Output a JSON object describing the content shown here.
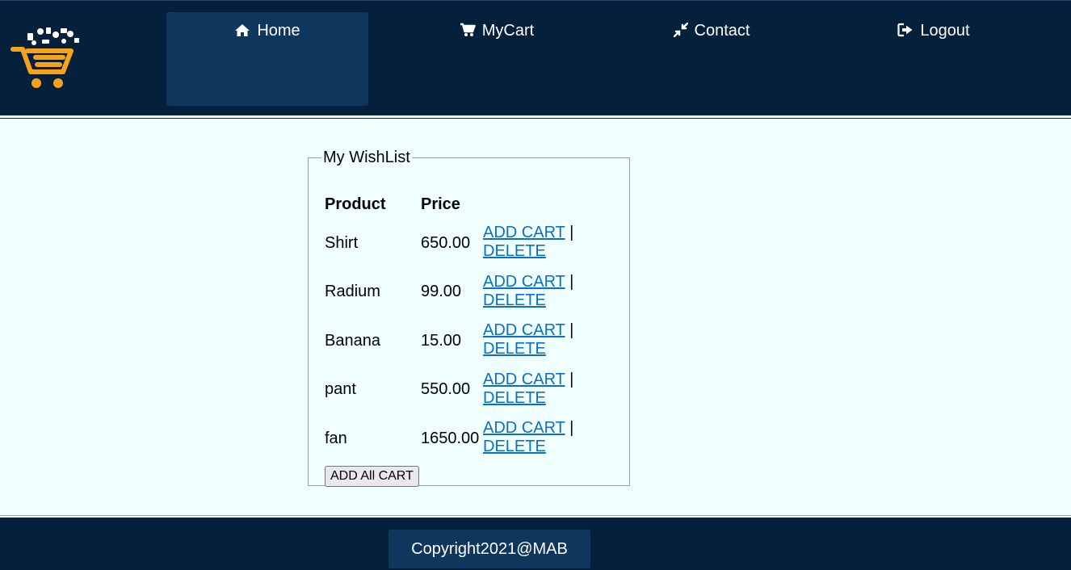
{
  "header": {
    "nav": [
      {
        "label": "Home",
        "icon": "home-icon",
        "active": true
      },
      {
        "label": "MyCart",
        "icon": "cart-icon",
        "active": false
      },
      {
        "label": "Contact",
        "icon": "compress-icon",
        "active": false
      },
      {
        "label": "Logout",
        "icon": "logout-icon",
        "active": false
      }
    ]
  },
  "wishlist": {
    "legend": "My WishList",
    "columns": [
      "Product",
      "Price"
    ],
    "rows": [
      {
        "product": "Shirt",
        "price": "650.00",
        "add": "ADD CART",
        "sep": "|",
        "delete": "DELETE"
      },
      {
        "product": "Radium",
        "price": "99.00",
        "add": "ADD CART",
        "sep": "|",
        "delete": "DELETE"
      },
      {
        "product": "Banana",
        "price": "15.00",
        "add": "ADD CART",
        "sep": "|",
        "delete": "DELETE"
      },
      {
        "product": "pant",
        "price": "550.00",
        "add": "ADD CART",
        "sep": "|",
        "delete": "DELETE"
      },
      {
        "product": "fan",
        "price": "1650.00",
        "add": "ADD CART",
        "sep": "|",
        "delete": "DELETE"
      }
    ],
    "add_all_label": "ADD All CART"
  },
  "footer": {
    "copyright": "Copyright2021@MAB"
  },
  "colors": {
    "header_bg": "#05203b",
    "nav_active": "#0f365d",
    "page_bg": "#f0ffff",
    "link": "#0b6fc6",
    "logo_orange": "#f7a21b"
  }
}
